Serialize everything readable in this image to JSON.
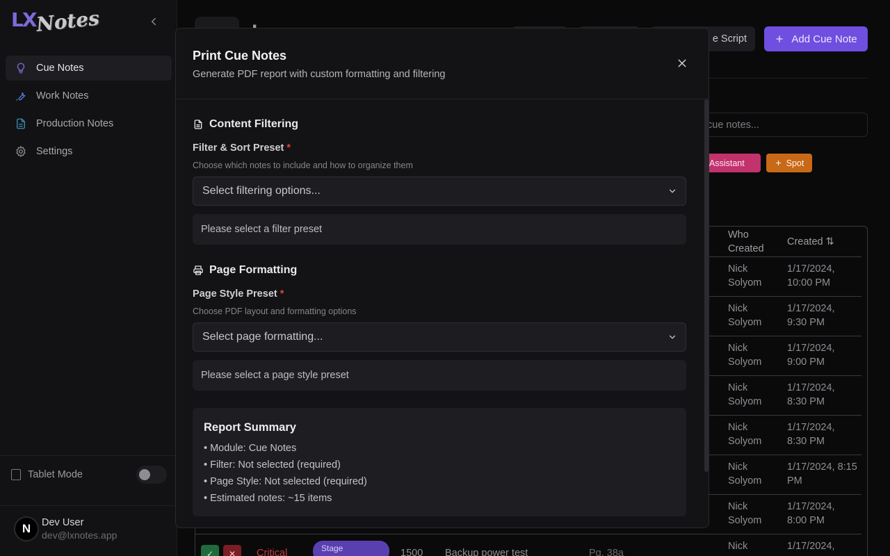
{
  "sidebar": {
    "logo_lx": "LX",
    "logo_notes": "Notes",
    "items": [
      {
        "label": "Cue Notes",
        "icon": "lightbulb-icon",
        "active": true
      },
      {
        "label": "Work Notes",
        "icon": "wrench-icon",
        "active": false
      },
      {
        "label": "Production Notes",
        "icon": "document-icon",
        "active": false
      },
      {
        "label": "Settings",
        "icon": "gear-icon",
        "active": false
      }
    ],
    "tablet_mode_label": "Tablet Mode",
    "tablet_mode_on": false,
    "user": {
      "initial": "N",
      "name": "Dev User",
      "email": "dev@lxnotes.app"
    }
  },
  "background": {
    "header_title": "Lx",
    "script_button_label": "e Script",
    "add_button_label": "Add Cue Note",
    "search_placeholder": "cue notes...",
    "chips": {
      "assistant": "Assistant",
      "spot": "Spot"
    },
    "table": {
      "headers": {
        "who_created_1": "Who",
        "who_created_2": "Created",
        "created": "Created ⇅"
      },
      "rows": [
        {
          "who_1": "Nick",
          "who_2": "Solyom",
          "created_1": "1/17/2024,",
          "created_2": "10:00 PM"
        },
        {
          "who_1": "Nick",
          "who_2": "Solyom",
          "created_1": "1/17/2024,",
          "created_2": "9:30 PM"
        },
        {
          "who_1": "Nick",
          "who_2": "Solyom",
          "created_1": "1/17/2024,",
          "created_2": "9:00 PM"
        },
        {
          "who_1": "Nick",
          "who_2": "Solyom",
          "created_1": "1/17/2024,",
          "created_2": "8:30 PM"
        },
        {
          "who_1": "Nick",
          "who_2": "Solyom",
          "created_1": "1/17/2024,",
          "created_2": "8:30 PM"
        },
        {
          "who_1": "Nick",
          "who_2": "Solyom",
          "created_1": "1/17/2024, 8:15",
          "created_2": "PM"
        },
        {
          "who_1": "Nick",
          "who_2": "Solyom",
          "created_1": "1/17/2024,",
          "created_2": "8:00 PM"
        },
        {
          "who_1": "Nick",
          "who_2": "",
          "created_1": "1/17/2024,",
          "created_2": ""
        }
      ],
      "last_row": {
        "priority": "Critical",
        "type": "Stage",
        "cue": "1500",
        "description": "Backup power test",
        "ref": "Pg. 38a"
      }
    }
  },
  "modal": {
    "title": "Print Cue Notes",
    "subtitle": "Generate PDF report with custom formatting and filtering",
    "content_section": {
      "heading": "Content Filtering",
      "label": "Filter & Sort Preset",
      "required_mark": "*",
      "help": "Choose which notes to include and how to organize them",
      "select_value": "Select filtering options...",
      "notice": "Please select a filter preset"
    },
    "format_section": {
      "heading": "Page Formatting",
      "label": "Page Style Preset",
      "required_mark": "*",
      "help": "Choose PDF layout and formatting options",
      "select_value": "Select page formatting...",
      "notice": "Please select a page style preset"
    },
    "summary": {
      "title": "Report Summary",
      "lines": [
        "• Module: Cue Notes",
        "• Filter: Not selected (required)",
        "• Page Style: Not selected (required)",
        "• Estimated notes: ~15 items"
      ]
    }
  },
  "colors": {
    "accent": "#6f4ee0",
    "required": "#e0413b",
    "background": "#0c0c0d"
  }
}
